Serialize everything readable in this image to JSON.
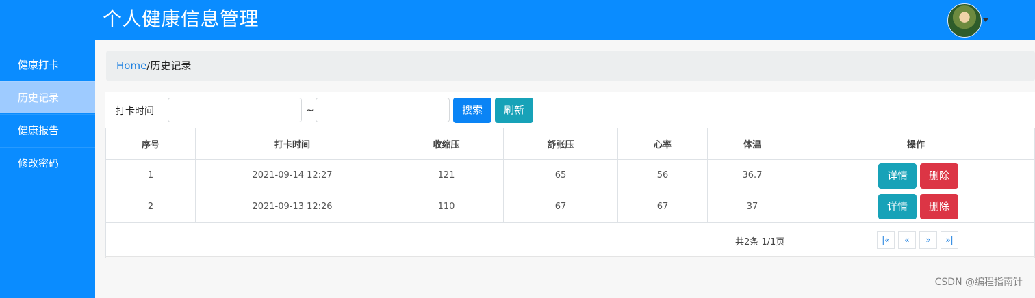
{
  "app": {
    "title": "个人健康信息管理"
  },
  "sidebar": {
    "items": [
      {
        "label": "健康打卡"
      },
      {
        "label": "历史记录",
        "active": true
      },
      {
        "label": "健康报告"
      },
      {
        "label": "修改密码"
      }
    ]
  },
  "breadcrumb": {
    "home": "Home",
    "separator": "/",
    "current": "历史记录"
  },
  "filters": {
    "label": "打卡时间",
    "range_separator": "~",
    "start_value": "",
    "end_value": "",
    "search_label": "搜索",
    "refresh_label": "刷新"
  },
  "table": {
    "headers": [
      "序号",
      "打卡时间",
      "收缩压",
      "舒张压",
      "心率",
      "体温",
      "操作"
    ],
    "rows": [
      {
        "index": "1",
        "time": "2021-09-14 12:27",
        "systolic": "121",
        "diastolic": "65",
        "heart_rate": "56",
        "temperature": "36.7"
      },
      {
        "index": "2",
        "time": "2021-09-13 12:26",
        "systolic": "110",
        "diastolic": "67",
        "heart_rate": "67",
        "temperature": "37"
      }
    ],
    "action_labels": {
      "detail": "详情",
      "delete": "删除"
    }
  },
  "pagination": {
    "info": "共2条 1/1页",
    "first": "|«",
    "prev": "«",
    "next": "»",
    "last": "»|"
  },
  "watermark": "CSDN @编程指南针"
}
